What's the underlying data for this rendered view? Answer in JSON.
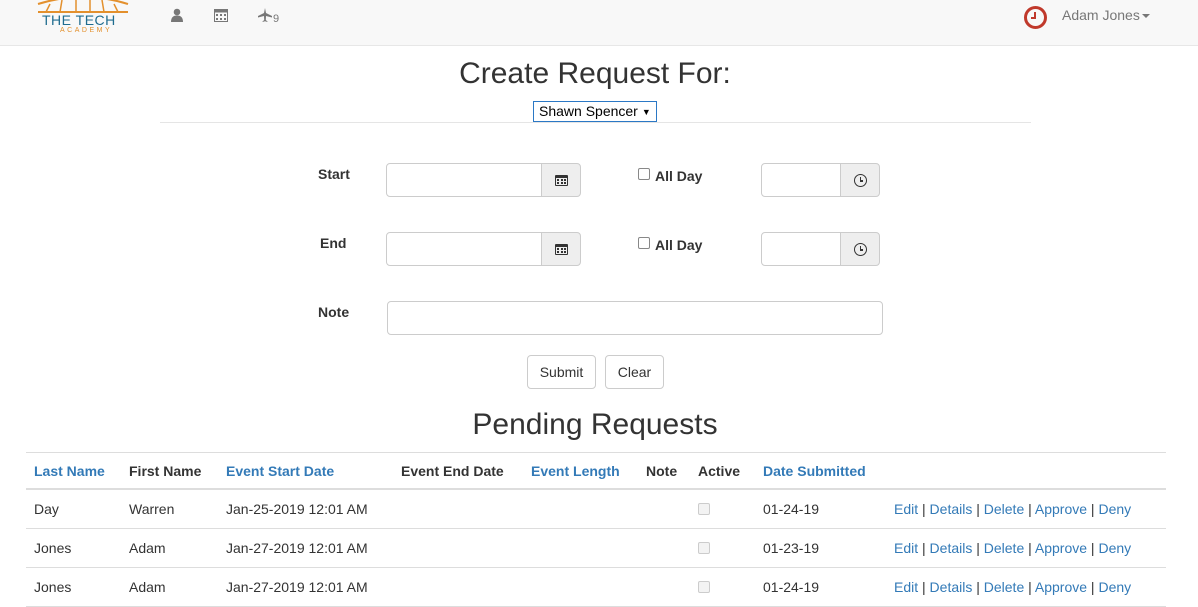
{
  "navbar": {
    "logo_text": "THE TECH",
    "logo_subtext": "ACADEMY",
    "notification_count": "9",
    "user_name": "Adam Jones"
  },
  "form": {
    "title": "Create Request For:",
    "selected_employee": "Shawn Spencer",
    "start_label": "Start",
    "end_label": "End",
    "note_label": "Note",
    "all_day_label": "All Day",
    "start_date_value": "",
    "start_time_value": "",
    "end_date_value": "",
    "end_time_value": "",
    "note_value": "",
    "submit_label": "Submit",
    "clear_label": "Clear"
  },
  "pending": {
    "title": "Pending Requests",
    "headers": {
      "last_name": "Last Name",
      "first_name": "First Name",
      "event_start": "Event Start Date",
      "event_end": "Event End Date",
      "event_length": "Event Length",
      "note": "Note",
      "active": "Active",
      "date_submitted": "Date Submitted"
    },
    "action_labels": {
      "edit": "Edit",
      "details": "Details",
      "delete": "Delete",
      "approve": "Approve",
      "deny": "Deny",
      "separator": " | "
    },
    "rows": [
      {
        "last": "Day",
        "first": "Warren",
        "start": "Jan-25-2019 12:01 AM",
        "end": "",
        "length": "",
        "note": "",
        "active": false,
        "submitted": "01-24-19"
      },
      {
        "last": "Jones",
        "first": "Adam",
        "start": "Jan-27-2019 12:01 AM",
        "end": "",
        "length": "",
        "note": "",
        "active": false,
        "submitted": "01-23-19"
      },
      {
        "last": "Jones",
        "first": "Adam",
        "start": "Jan-27-2019 12:01 AM",
        "end": "",
        "length": "",
        "note": "",
        "active": false,
        "submitted": "01-24-19"
      }
    ]
  }
}
